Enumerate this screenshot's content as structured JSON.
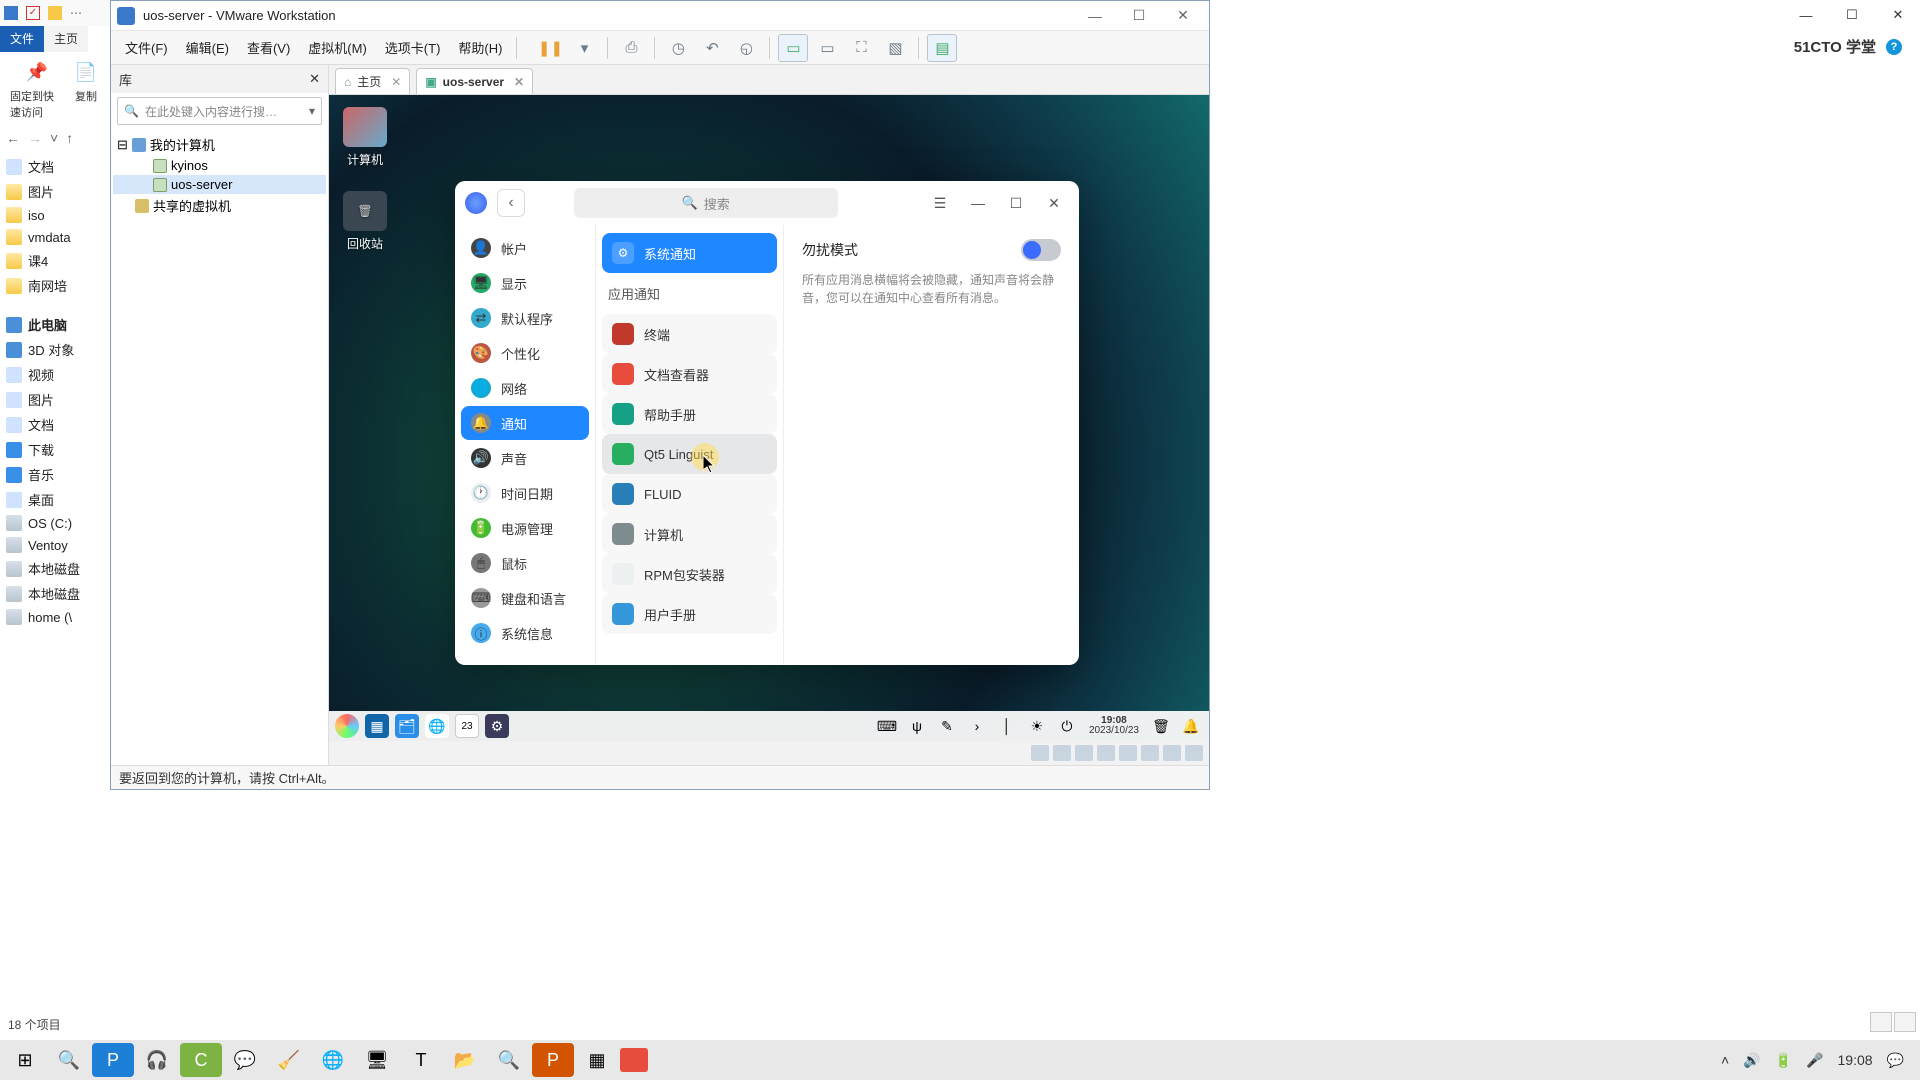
{
  "host_window": {
    "brand": "51CTO 学堂",
    "sys_buttons": {
      "min": "—",
      "max": "☐",
      "close": "✕"
    }
  },
  "explorer": {
    "tabs": {
      "file": "文件",
      "home": "主页"
    },
    "quick": [
      {
        "label": "固定到快速访问",
        "icon": "📌"
      },
      {
        "label": "复制",
        "icon": "📄"
      }
    ],
    "nav_icons": {
      "back": "←",
      "forward": "→",
      "dropdown": "˅",
      "up": "↑"
    },
    "tree": [
      {
        "icon": "file",
        "label": "文档"
      },
      {
        "icon": "folder",
        "label": "图片"
      },
      {
        "icon": "folder",
        "label": "iso"
      },
      {
        "icon": "folder",
        "label": "vmdata"
      },
      {
        "icon": "folder",
        "label": "课4"
      },
      {
        "icon": "folder",
        "label": "南网培"
      },
      {
        "icon": "pc",
        "label": "此电脑",
        "bold": true,
        "mt": true
      },
      {
        "icon": "pc",
        "label": "3D 对象"
      },
      {
        "icon": "file",
        "label": "视频"
      },
      {
        "icon": "file",
        "label": "图片"
      },
      {
        "icon": "file",
        "label": "文档"
      },
      {
        "icon": "file",
        "label": "下载",
        "blue": true
      },
      {
        "icon": "file",
        "label": "音乐",
        "blue": true
      },
      {
        "icon": "file",
        "label": "桌面"
      },
      {
        "icon": "drive",
        "label": "OS (C:)"
      },
      {
        "icon": "drive",
        "label": "Ventoy"
      },
      {
        "icon": "drive",
        "label": "本地磁盘"
      },
      {
        "icon": "drive",
        "label": "本地磁盘"
      },
      {
        "icon": "drive",
        "label": "home (\\"
      }
    ],
    "status": "18 个项目"
  },
  "vmware": {
    "title": "uos-server - VMware Workstation",
    "menus": [
      "文件(F)",
      "编辑(E)",
      "查看(V)",
      "虚拟机(M)",
      "选项卡(T)",
      "帮助(H)"
    ],
    "library": {
      "title": "库",
      "close": "✕",
      "search_placeholder": "在此处键入内容进行搜…"
    },
    "tree": {
      "root": "我的计算机",
      "children": [
        "kyinos",
        "uos-server"
      ],
      "shared": "共享的虚拟机"
    },
    "tabs": [
      {
        "label": "主页",
        "icon": "⌂"
      },
      {
        "label": "uos-server",
        "icon": "▣",
        "active": true
      }
    ],
    "hint": "要返回到您的计算机，请按 Ctrl+Alt。"
  },
  "guest": {
    "desktop": [
      {
        "label": "计算机"
      },
      {
        "label": "回收站"
      }
    ],
    "settings": {
      "search": "搜索",
      "categories": [
        {
          "label": "帐户",
          "icon": "👤",
          "bg": "#444"
        },
        {
          "label": "显示",
          "icon": "🖥",
          "bg": "#2a6"
        },
        {
          "label": "默认程序",
          "icon": "⇄",
          "bg": "#3ac"
        },
        {
          "label": "个性化",
          "icon": "🎨",
          "bg": "#b54"
        },
        {
          "label": "网络",
          "icon": "🌐",
          "bg": "#1ac"
        },
        {
          "label": "通知",
          "icon": "🔔",
          "bg": "#888",
          "sel": true
        },
        {
          "label": "声音",
          "icon": "🔊",
          "bg": "#333"
        },
        {
          "label": "时间日期",
          "icon": "🕐",
          "bg": "#eee"
        },
        {
          "label": "电源管理",
          "icon": "🔋",
          "bg": "#4b3"
        },
        {
          "label": "鼠标",
          "icon": "🖱",
          "bg": "#777"
        },
        {
          "label": "键盘和语言",
          "icon": "⌨",
          "bg": "#999"
        },
        {
          "label": "系统信息",
          "icon": "ⓘ",
          "bg": "#4ae"
        }
      ],
      "mid": {
        "system": {
          "label": "系统通知",
          "icon": "⚙"
        },
        "section": "应用通知",
        "apps": [
          {
            "label": "终端",
            "bg": "#c0392b"
          },
          {
            "label": "文档查看器",
            "bg": "#e74c3c"
          },
          {
            "label": "帮助手册",
            "bg": "#16a085"
          },
          {
            "label": "Qt5 Linguist",
            "bg": "#27ae60",
            "hov": true
          },
          {
            "label": "FLUID",
            "bg": "#2980b9"
          },
          {
            "label": "计算机",
            "bg": "#7f8c8d"
          },
          {
            "label": "RPM包安装器",
            "bg": "#ecf0f1"
          },
          {
            "label": "用户手册",
            "bg": "#3498db"
          }
        ]
      },
      "right": {
        "title": "勿扰模式",
        "desc": "所有应用消息横幅将会被隐藏，通知声音将会静音，您可以在通知中心查看所有消息。"
      }
    },
    "taskbar": {
      "date_badge": "23",
      "time": "19:08",
      "date": "2023/10/23"
    }
  },
  "win_taskbar": {
    "time": "19:08",
    "apps": [
      "⊞",
      "🔍",
      "P",
      "🎧",
      "C",
      "💬",
      "🧹",
      "🌐",
      "📁",
      "T",
      "📂",
      "🔍",
      "P",
      "▦",
      "🟧"
    ]
  }
}
